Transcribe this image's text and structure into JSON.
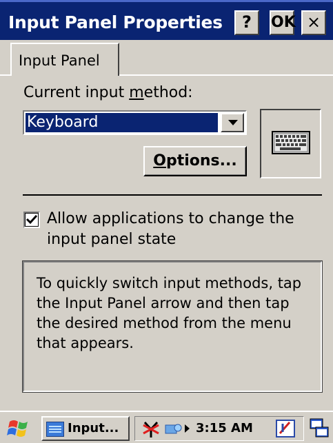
{
  "window": {
    "title": "Input Panel Properties",
    "help_label": "?",
    "ok_label": "OK",
    "close_label": "×"
  },
  "tabs": [
    {
      "label": "Input Panel",
      "selected": true
    }
  ],
  "input_method": {
    "label_prefix": "Current input method:",
    "selected": "Keyboard",
    "options_button": "Options..."
  },
  "allow_checkbox": {
    "checked": true,
    "label": "Allow applications to change the input panel state"
  },
  "hint": {
    "text": "To quickly switch input methods, tap the Input Panel arrow and then tap the desired method from the menu that appears."
  },
  "taskbar": {
    "task_label": "Input...",
    "clock": "3:15 AM",
    "icons": [
      "start-icon",
      "input-panel-icon",
      "network-icon",
      "connection-icon",
      "tray-arrow-icon",
      "input-method-icon",
      "desktop-icon"
    ]
  },
  "colors": {
    "titlebar": "#0a2472",
    "selection": "#0a2472",
    "face": "#d4d0c8"
  }
}
